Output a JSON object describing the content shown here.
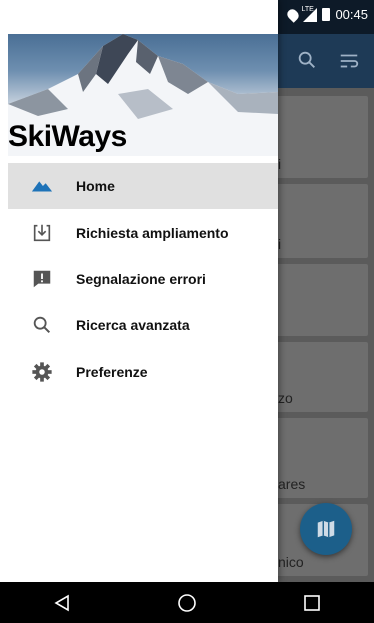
{
  "status_bar": {
    "time": "00:45",
    "network_label": "LTE",
    "icons": [
      "android-icon",
      "location-icon",
      "signal-icon",
      "battery-icon"
    ]
  },
  "drawer": {
    "header_title": "SkiWays",
    "items": [
      {
        "label": "Home",
        "icon": "mountain-icon",
        "active": true
      },
      {
        "label": "Richiesta ampliamento",
        "icon": "download-box-icon",
        "active": false
      },
      {
        "label": "Segnalazione errori",
        "icon": "report-icon",
        "active": false
      },
      {
        "label": "Ricerca avanzata",
        "icon": "search-icon",
        "active": false
      },
      {
        "label": "Preferenze",
        "icon": "gear-icon",
        "active": false
      }
    ]
  },
  "background": {
    "appbar_icons": [
      "search-icon",
      "filter-icon"
    ],
    "card_fragments": [
      "i",
      "i",
      "zo",
      "ares",
      "nico"
    ],
    "fab_icon": "map-icon"
  },
  "colors": {
    "accent": "#1e3a56",
    "fab": "#1c5f8a",
    "active_item_bg": "#e0e0e0",
    "mountain_icon": "#1e73b8"
  },
  "nav_bar": {
    "buttons": [
      "back-icon",
      "home-icon",
      "recents-icon"
    ]
  }
}
